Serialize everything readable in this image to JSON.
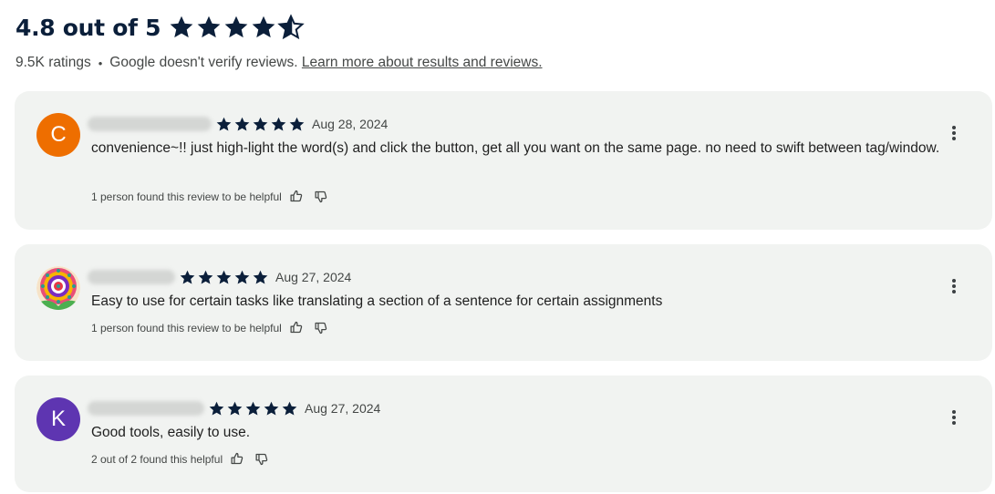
{
  "summary": {
    "rating_text": "4.8 out of 5",
    "rating_value": 4.8,
    "ratings_count": "9.5K ratings",
    "separator": "•",
    "verify_note": "Google doesn't verify reviews.",
    "learn_more": "Learn more about results and reviews."
  },
  "colors": {
    "star": "#0b1f3a",
    "card_bg": "#f1f3f1",
    "avatar_orange": "#ee6e00",
    "avatar_purple": "#5e35b1"
  },
  "reviews": [
    {
      "avatar_letter": "C",
      "stars": 5,
      "date": "Aug 28, 2024",
      "text": "convenience~!! just high-light the word(s) and click the button, get all you want on the same page. no need to swift between tag/window.",
      "helpful": "1 person found this review to be helpful"
    },
    {
      "avatar_letter": "",
      "stars": 5,
      "date": "Aug 27, 2024",
      "text": "Easy to use for certain tasks like translating a section of a sentence for certain assignments",
      "helpful": "1 person found this review to be helpful"
    },
    {
      "avatar_letter": "K",
      "stars": 5,
      "date": "Aug 27, 2024",
      "text": "Good tools, easily to use.",
      "helpful": "2 out of 2 found this helpful"
    }
  ],
  "icons": {
    "star": "star-icon",
    "half_star": "half-star-icon",
    "thumbs_up": "thumbs-up-icon",
    "thumbs_down": "thumbs-down-icon",
    "more": "more-vert-icon"
  }
}
